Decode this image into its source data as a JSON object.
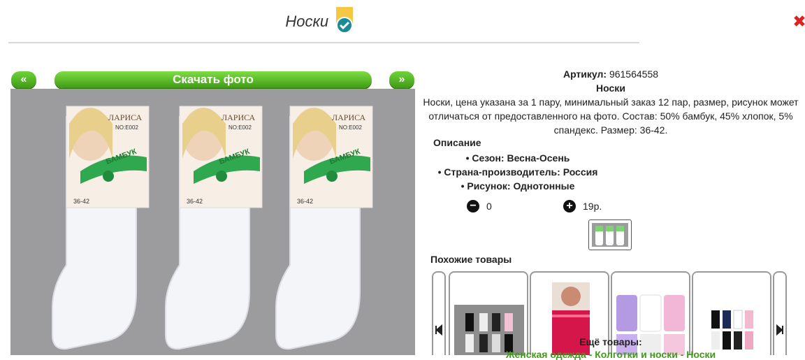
{
  "header": {
    "title": "Носки"
  },
  "gallery": {
    "prev_label": "«",
    "next_label": "»",
    "download_label": "Скачать фото",
    "photo": {
      "brand": "ЛАРИСА",
      "model": "NO:E002",
      "ribbon": "БАМБУК",
      "size": "36-42"
    }
  },
  "product": {
    "sku_label": "Артикул:",
    "sku": "961564558",
    "name": "Носки",
    "description": "Носки, цена указана за 1 пару, минимальный заказ 12 пар, размер, рисунок может отличаться от предоставленного на фото. Состав: 50% бамбук, 45% хлопок, 5% спандекс. Размер: 36-42.",
    "desc_title": "Описание",
    "properties": [
      "Сезон: Весна-Осень",
      "Страна-производитель: Россия",
      "Рисунок: Однотонные"
    ]
  },
  "cart": {
    "minus": "−",
    "plus": "+",
    "quantity": "0",
    "price": "19р."
  },
  "similar": {
    "title": "Похожие товары"
  },
  "footer": {
    "more_label": "Ещё товары:",
    "breadcrumbs": "Женская одежда - Колготки и носки - Носки"
  },
  "colors": {
    "accent": "#3f9b14",
    "accent_light": "#7edc44",
    "photo_bg": "#9c9c9e"
  }
}
